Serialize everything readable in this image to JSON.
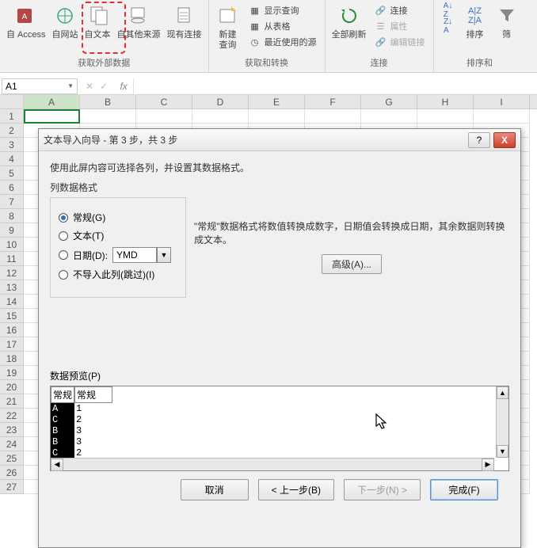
{
  "ribbon": {
    "group1_label": "获取外部数据",
    "from_access": "自 Access",
    "from_web": "自网站",
    "from_text": "自文本",
    "from_other": "自其他来源",
    "existing_conn": "现有连接",
    "group2_label": "获取和转换",
    "new_query": "新建\n查询",
    "show_query": "显示查询",
    "from_table": "从表格",
    "recent_sources": "最近使用的源",
    "group3_label": "连接",
    "refresh_all": "全部刷新",
    "connections": "连接",
    "properties": "属性",
    "edit_links": "编辑链接",
    "group4_label": "排序和",
    "sort_az": "",
    "sort": "排序",
    "filter": "筛"
  },
  "namebox": {
    "value": "A1",
    "fx": "fx"
  },
  "columns": [
    "A",
    "B",
    "C",
    "D",
    "E",
    "F",
    "G",
    "H",
    "I"
  ],
  "rows": [
    "1",
    "2",
    "3",
    "4",
    "5",
    "6",
    "7",
    "8",
    "9",
    "10",
    "11",
    "12",
    "13",
    "14",
    "15",
    "16",
    "17",
    "18",
    "19",
    "20",
    "21",
    "22",
    "23",
    "24",
    "25",
    "26",
    "27"
  ],
  "dialog": {
    "title": "文本导入向导 - 第 3 步，共 3 步",
    "help": "?",
    "close": "X",
    "instruction": "使用此屏内容可选择各列，并设置其数据格式。",
    "format_label": "列数据格式",
    "radio_general": "常规(G)",
    "radio_text": "文本(T)",
    "radio_date": "日期(D):",
    "date_value": "YMD",
    "radio_skip": "不导入此列(跳过)(I)",
    "desc": "\"常规\"数据格式将数值转换成数字，日期值会转换成日期，其余数据则转换成文本。",
    "advanced": "高级(A)...",
    "preview_label": "数据预览(P)",
    "preview_headers": [
      "常规",
      "常规"
    ],
    "preview_data": [
      [
        "A",
        "1"
      ],
      [
        "C",
        "2"
      ],
      [
        "B",
        "3"
      ],
      [
        "B",
        "3"
      ],
      [
        "C",
        "2"
      ]
    ],
    "btn_cancel": "取消",
    "btn_back": "< 上一步(B)",
    "btn_next": "下一步(N) >",
    "btn_finish": "完成(F)"
  }
}
